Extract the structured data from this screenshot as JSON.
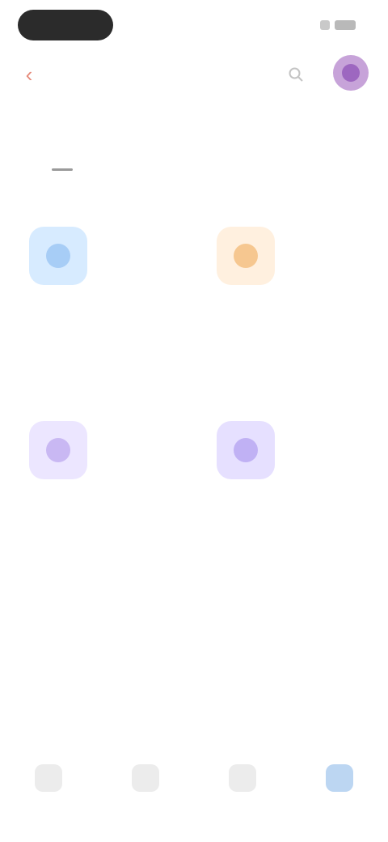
{
  "status_bar": {
    "time": ""
  },
  "header": {
    "back_icon": "chevron-left-icon",
    "search_icon": "search-icon",
    "avatar_icon": "avatar"
  },
  "page": {
    "title": ""
  },
  "tabs": [
    {
      "label": "",
      "active": false
    },
    {
      "label": "",
      "active": true
    },
    {
      "label": "",
      "active": false
    },
    {
      "label": "",
      "active": false
    },
    {
      "label": "",
      "active": false
    },
    {
      "label": "",
      "active": false
    }
  ],
  "cards": [
    {
      "title": "",
      "description": "",
      "icon": "blue-tile-icon",
      "color": "#d7ebff",
      "dot": "#a7cdf6"
    },
    {
      "title": "",
      "description": "",
      "icon": "orange-tile-icon",
      "color": "#fff0df",
      "dot": "#f6c790"
    },
    {
      "title": "",
      "description": "",
      "icon": "purple-tile-icon",
      "color": "#ece6ff",
      "dot": "#c9b8f3"
    },
    {
      "title": "",
      "description": "",
      "icon": "purple-tile-icon",
      "color": "#e6e0ff",
      "dot": "#c0b1f4"
    }
  ],
  "bottom_nav": [
    {
      "label": "",
      "icon": "home-icon",
      "active": false
    },
    {
      "label": "",
      "icon": "grid-icon",
      "active": false
    },
    {
      "label": "",
      "icon": "chat-icon",
      "active": false
    },
    {
      "label": "",
      "icon": "profile-icon",
      "active": true
    }
  ],
  "colors": {
    "accent": "#6f9fd3",
    "back": "#e68a7a",
    "avatar": "#9d67c0"
  }
}
